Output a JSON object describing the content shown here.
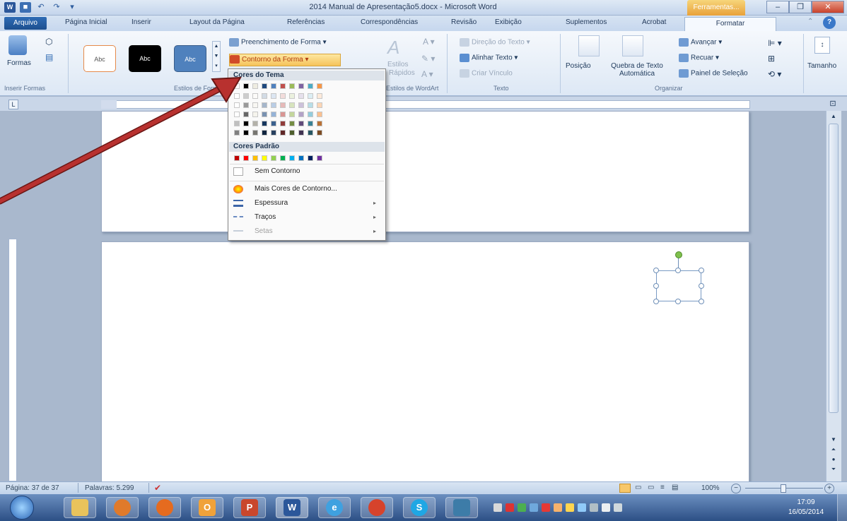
{
  "window": {
    "title": "2014 Manual de Apresentação5.docx - Microsoft Word",
    "context_tab": "Ferramentas..."
  },
  "tabs": [
    "Arquivo",
    "Página Inicial",
    "Inserir",
    "Layout da Página",
    "Referências",
    "Correspondências",
    "Revisão",
    "Exibição",
    "Suplementos",
    "Acrobat",
    "Formatar"
  ],
  "ribbon": {
    "insert_shapes": {
      "label": "Inserir Formas",
      "shapes_button": "Formas"
    },
    "shape_styles": {
      "label": "Estilos de Forma",
      "samples": [
        "Abc",
        "Abc",
        "Abc"
      ],
      "fill": "Preenchimento de Forma",
      "outline": "Contorno da Forma"
    },
    "wordart": {
      "label": "Estilos de WordArt",
      "fragment1": "Estilos",
      "fragment2": "Rápidos"
    },
    "text": {
      "label": "Texto",
      "direction": "Direção do Texto",
      "align": "Alinhar Texto",
      "link": "Criar Vínculo"
    },
    "arrange": {
      "label": "Organizar",
      "position": "Posição",
      "wrap": "Quebra de Texto Automática",
      "forward": "Avançar",
      "backward": "Recuar",
      "selection": "Painel de Seleção"
    },
    "size": {
      "label": "Tamanho"
    }
  },
  "dropdown": {
    "theme_header": "Cores do Tema",
    "standard_header": "Cores Padrão",
    "no_outline": "Sem Contorno",
    "more_colors": "Mais Cores de Contorno...",
    "weight": "Espessura",
    "dashes": "Traços",
    "arrows": "Setas",
    "theme_colors": [
      "#ffffff",
      "#000000",
      "#eeece1",
      "#1f497d",
      "#4f81bd",
      "#c0504d",
      "#9bbb59",
      "#8064a2",
      "#4bacc6",
      "#f79646"
    ],
    "standard_colors": [
      "#c00000",
      "#ff0000",
      "#ffc000",
      "#ffff00",
      "#92d050",
      "#00b050",
      "#00b0f0",
      "#0070c0",
      "#002060",
      "#7030a0"
    ]
  },
  "statusbar": {
    "page": "Página: 37 de 37",
    "words": "Palavras: 5.299",
    "zoom": "100%"
  },
  "taskbar": {
    "time": "17:09",
    "date": "16/05/2014"
  },
  "colors": {
    "annotation_arrow": "#b8312f",
    "ribbon_blue": "#2b579a"
  }
}
